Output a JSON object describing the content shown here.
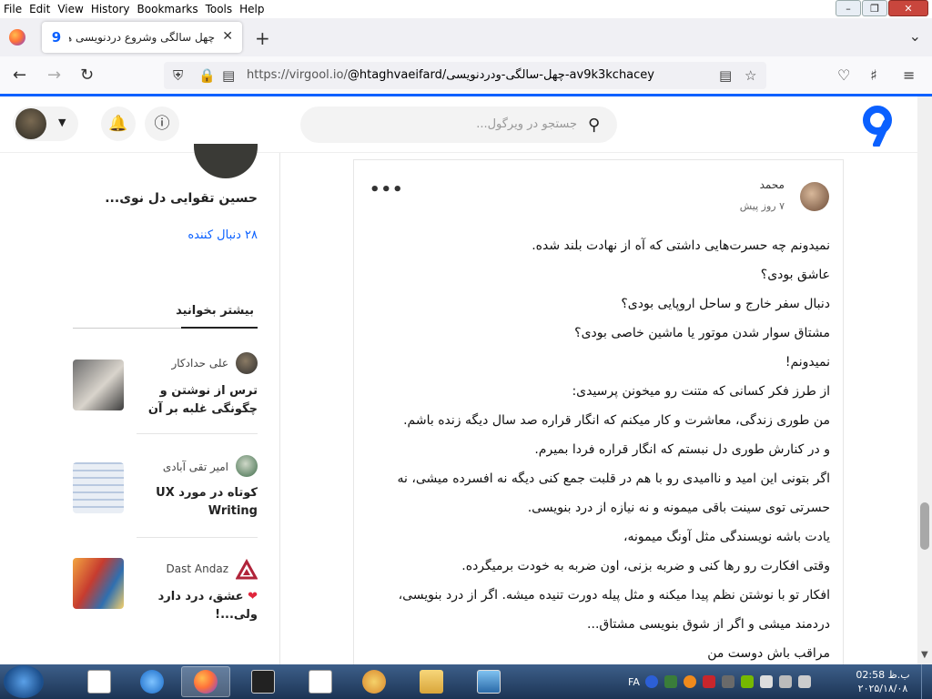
{
  "menubar": {
    "items": [
      "File",
      "Edit",
      "View",
      "History",
      "Bookmarks",
      "Tools",
      "Help"
    ]
  },
  "browser": {
    "tab_title": "چهل سالگی وشروع دردنویسی های",
    "url_host": "https://virgool.io/",
    "url_path": "@htaghvaeifard/چهل-سالگی-ودردنویسی-av9k3kchacey"
  },
  "site": {
    "search_placeholder": "جستجو در ویرگول..."
  },
  "comment": {
    "author": "محمد",
    "time": "۷ روز پیش",
    "lines": [
      "نمیدونم چه حسرت‌هایی داشتی که آه از نهادت بلند شده.",
      "عاشق بودی؟",
      "دنبال سفر خارج و ساحل اروپایی بودی؟",
      "مشتاق سوار شدن موتور یا ماشین خاصی بودی؟",
      "نمیدونم!",
      "از طرز فکر کسانی که متنت رو میخونن پرسیدی:",
      "من طوری زندگی، معاشرت و کار میکنم که انگار قراره صد سال دیگه زنده باشم.",
      "و در کنارش طوری دل نبستم که انگار قراره فردا بمیرم.",
      "اگر بتونی این امید و ناامیدی رو با هم در قلبت جمع کنی دیگه نه افسرده میشی، نه",
      "حسرتی توی سینت باقی میمونه و نه نیازه از درد بنویسی.",
      "یادت باشه نویسندگی مثل آونگ میمونه،",
      "وقتی افکارت رو رها کنی و ضربه بزنی، اون ضربه به خودت برمیگرده.",
      "افکار تو با نوشتن نظم پیدا میکنه و مثل پیله دورت تنیده میشه. اگر از درد بنویسی،",
      "دردمند میشی و اگر از شوق بنویسی مشتاق...",
      "مراقب باش دوست من"
    ]
  },
  "sidebar": {
    "author_name": "حسین تقوایی دل نوی...",
    "followers": "۲۸ دنبال کننده",
    "more_title": "بیشتر بخوانید",
    "recommendations": [
      {
        "author": "علی حدادکار",
        "title": "ترس از نوشتن و چگونگی غلبه بر آن"
      },
      {
        "author": "امیر تقی آبادی",
        "title": "کوتاه در مورد UX Writing"
      },
      {
        "author": "Dast Andaz",
        "title": "عشق، درد دارد ولی...!"
      }
    ]
  },
  "taskbar": {
    "lang": "FA",
    "time": "02:58 ب.ظ",
    "date": "۲۰۲۵/۱۸/۰۸"
  },
  "colors": {
    "accent": "#0a60ff",
    "heart": "#e0263c"
  }
}
